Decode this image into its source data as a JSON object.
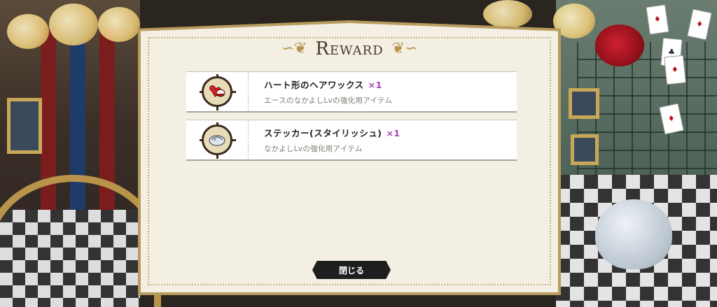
{
  "modal": {
    "title": "Reward",
    "close_label": "閉じる"
  },
  "rewards": [
    {
      "icon": "hair-wax-icon",
      "name": "ハート形のヘアワックス",
      "quantity": "×1",
      "description": "エースのなかよしLvの強化用アイテム"
    },
    {
      "icon": "sticker-icon",
      "name": "ステッカー(スタイリッシュ)",
      "quantity": "×1",
      "description": "なかよしLvの強化用アイテム"
    }
  ],
  "colors": {
    "quantity_accent": "#b03ab8",
    "frame_gold": "#b89c5e",
    "panel_bg": "#f3efe3"
  }
}
